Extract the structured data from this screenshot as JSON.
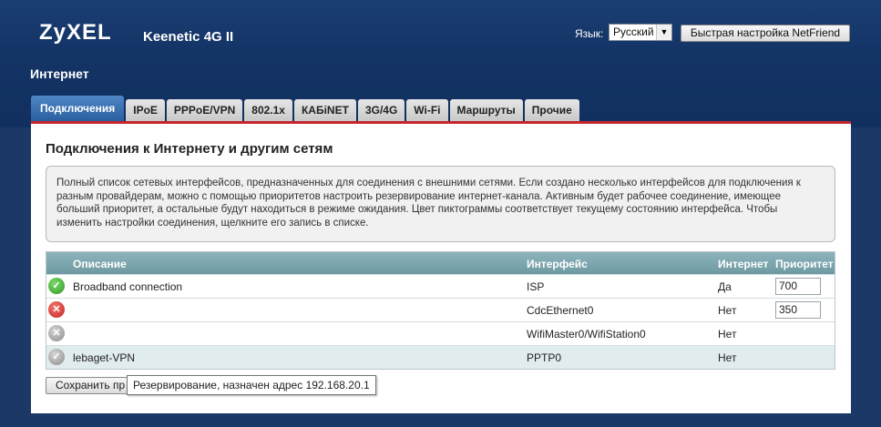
{
  "header": {
    "logo": "ZyXEL",
    "product": "Keenetic 4G II",
    "language_label": "Язык:",
    "language_value": "Русский",
    "quick_setup_label": "Быстрая настройка NetFriend"
  },
  "page_title": "Интернет",
  "tabs": [
    {
      "label": "Подключения",
      "active": true
    },
    {
      "label": "IPoE"
    },
    {
      "label": "PPPoE/VPN"
    },
    {
      "label": "802.1x"
    },
    {
      "label": "КАБiNET"
    },
    {
      "label": "3G/4G"
    },
    {
      "label": "Wi-Fi"
    },
    {
      "label": "Маршруты"
    },
    {
      "label": "Прочие"
    }
  ],
  "section_title": "Подключения к Интернету и другим сетям",
  "info_text": "Полный список сетевых интерфейсов, предназначенных для соединения с внешними сетями. Если создано несколько интерфейсов для подключения к разным провайдерам, можно с помощью приоритетов настроить резервирование интернет-канала. Активным будет рабочее соединение, имеющее больший приоритет, а остальные будут находиться в режиме ожидания. Цвет пиктограммы соответствует текущему состоянию интерфейса. Чтобы изменить настройки соединения, щелкните его запись в списке.",
  "table": {
    "headers": {
      "description": "Описание",
      "interface": "Интерфейс",
      "internet": "Интернет",
      "priority": "Приоритет"
    },
    "rows": [
      {
        "status": "ok",
        "status_icon": "check-icon",
        "description": "Broadband connection",
        "interface": "ISP",
        "internet": "Да",
        "priority": "700"
      },
      {
        "status": "error",
        "status_icon": "cross-icon",
        "description": "",
        "interface": "CdcEthernet0",
        "internet": "Нет",
        "priority": "350"
      },
      {
        "status": "disabled",
        "status_icon": "cross-icon",
        "description": "",
        "interface": "WifiMaster0/WifiStation0",
        "internet": "Нет",
        "priority": ""
      },
      {
        "status": "inactive",
        "status_icon": "check-icon",
        "description": "lebaget-VPN",
        "interface": "PPTP0",
        "internet": "Нет",
        "priority": ""
      }
    ]
  },
  "save_button_label": "Сохранить пр",
  "tooltip_text": "Резервирование, назначен адрес 192.168.20.1",
  "colors": {
    "header_bg": "#143466",
    "active_tab": "#2a5fa0",
    "accent_line": "#c4262d",
    "table_header": "#6e9aa3",
    "highlight_row": "#e1ecee"
  }
}
